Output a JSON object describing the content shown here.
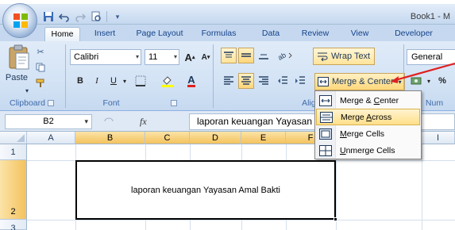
{
  "app": {
    "title": "Book1 - M",
    "colors": {
      "ribbon": "#d3e3f5",
      "accent": "#15428b",
      "highlight": "#ffd77a",
      "arrow": "#e02020"
    }
  },
  "quick_access": [
    "save-icon",
    "undo-icon",
    "redo-icon",
    "print-preview-icon",
    "customize-icon"
  ],
  "tabs": [
    {
      "label": "Home",
      "active": true
    },
    {
      "label": "Insert"
    },
    {
      "label": "Page Layout"
    },
    {
      "label": "Formulas"
    },
    {
      "label": "Data"
    },
    {
      "label": "Review"
    },
    {
      "label": "View"
    },
    {
      "label": "Developer"
    }
  ],
  "ribbon": {
    "clipboard": {
      "paste_label": "Paste",
      "group_label": "Clipboard"
    },
    "font": {
      "font_name": "Calibri",
      "font_size": "11",
      "grow_label": "A",
      "shrink_label": "A",
      "bold": "B",
      "italic": "I",
      "underline": "U",
      "font_color_label": "A",
      "group_label": "Font"
    },
    "alignment": {
      "wrap_text": "Wrap Text",
      "merge_center": "Merge & Center",
      "group_label": "Alignme"
    },
    "number": {
      "format": "General",
      "percent": "%",
      "group_label": "Num"
    }
  },
  "formula_bar": {
    "name_box": "B2",
    "fx": "fx",
    "value": "laporan keuangan Yayasan"
  },
  "grid": {
    "columns": [
      "A",
      "B",
      "C",
      "D",
      "E",
      "F"
    ],
    "partial_col": "I",
    "rows": [
      "1",
      "2",
      "3"
    ],
    "merged_cell_text": "laporan keuangan Yayasan Amal Bakti"
  },
  "merge_menu": {
    "items": [
      {
        "label": "Merge & Center",
        "ul": "C",
        "before": "Merge & ",
        "after": "enter"
      },
      {
        "label": "Merge Across",
        "ul": "A",
        "before": "Merge ",
        "after": "cross",
        "highlighted": true
      },
      {
        "label": "Merge Cells",
        "ul": "M",
        "before": "",
        "after": "erge Cells"
      },
      {
        "label": "Unmerge Cells",
        "ul": "U",
        "before": "",
        "after": "nmerge Cells"
      }
    ]
  }
}
